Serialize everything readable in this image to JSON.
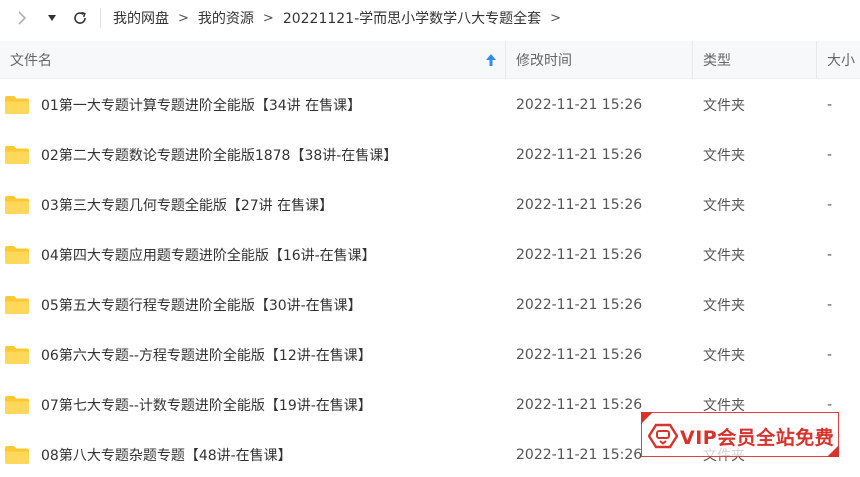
{
  "toolbar": {
    "forward_icon": "chevron-right-icon",
    "dropdown_icon": "caret-down-icon",
    "refresh_icon": "refresh-icon"
  },
  "breadcrumb": {
    "items": [
      "我的网盘",
      "我的资源",
      "20221121-学而思小学数学八大专题全套"
    ],
    "separator": ">"
  },
  "columns": {
    "name": "文件名",
    "modified": "修改时间",
    "type": "类型",
    "size": "大小"
  },
  "accent_color": "#2f8cf5",
  "folder_color": "#ffc933",
  "files": [
    {
      "name": "01第一大专题计算专题进阶全能版【34讲  在售课】",
      "modified": "2022-11-21 15:26",
      "type": "文件夹",
      "size": "-"
    },
    {
      "name": "02第二大专题数论专题进阶全能版1878【38讲-在售课】",
      "modified": "2022-11-21 15:26",
      "type": "文件夹",
      "size": "-"
    },
    {
      "name": "03第三大专题几何专题全能版【27讲 在售课】",
      "modified": "2022-11-21 15:26",
      "type": "文件夹",
      "size": "-"
    },
    {
      "name": "04第四大专题应用题专题进阶全能版【16讲-在售课】",
      "modified": "2022-11-21 15:26",
      "type": "文件夹",
      "size": "-"
    },
    {
      "name": "05第五大专题行程专题进阶全能版【30讲-在售课】",
      "modified": "2022-11-21 15:26",
      "type": "文件夹",
      "size": "-"
    },
    {
      "name": "06第六大专题--方程专题进阶全能版【12讲-在售课】",
      "modified": "2022-11-21 15:26",
      "type": "文件夹",
      "size": "-"
    },
    {
      "name": "07第七大专题--计数专题进阶全能版【19讲-在售课】",
      "modified": "2022-11-21 15:26",
      "type": "文件夹",
      "size": "-"
    },
    {
      "name": "08第八大专题杂题专题【48讲-在售课】",
      "modified": "2022-11-21 15:26",
      "type": "文件夹",
      "size": "-"
    }
  ],
  "watermark": {
    "text": "VIP会员全站免费",
    "color": "#d8322c"
  }
}
